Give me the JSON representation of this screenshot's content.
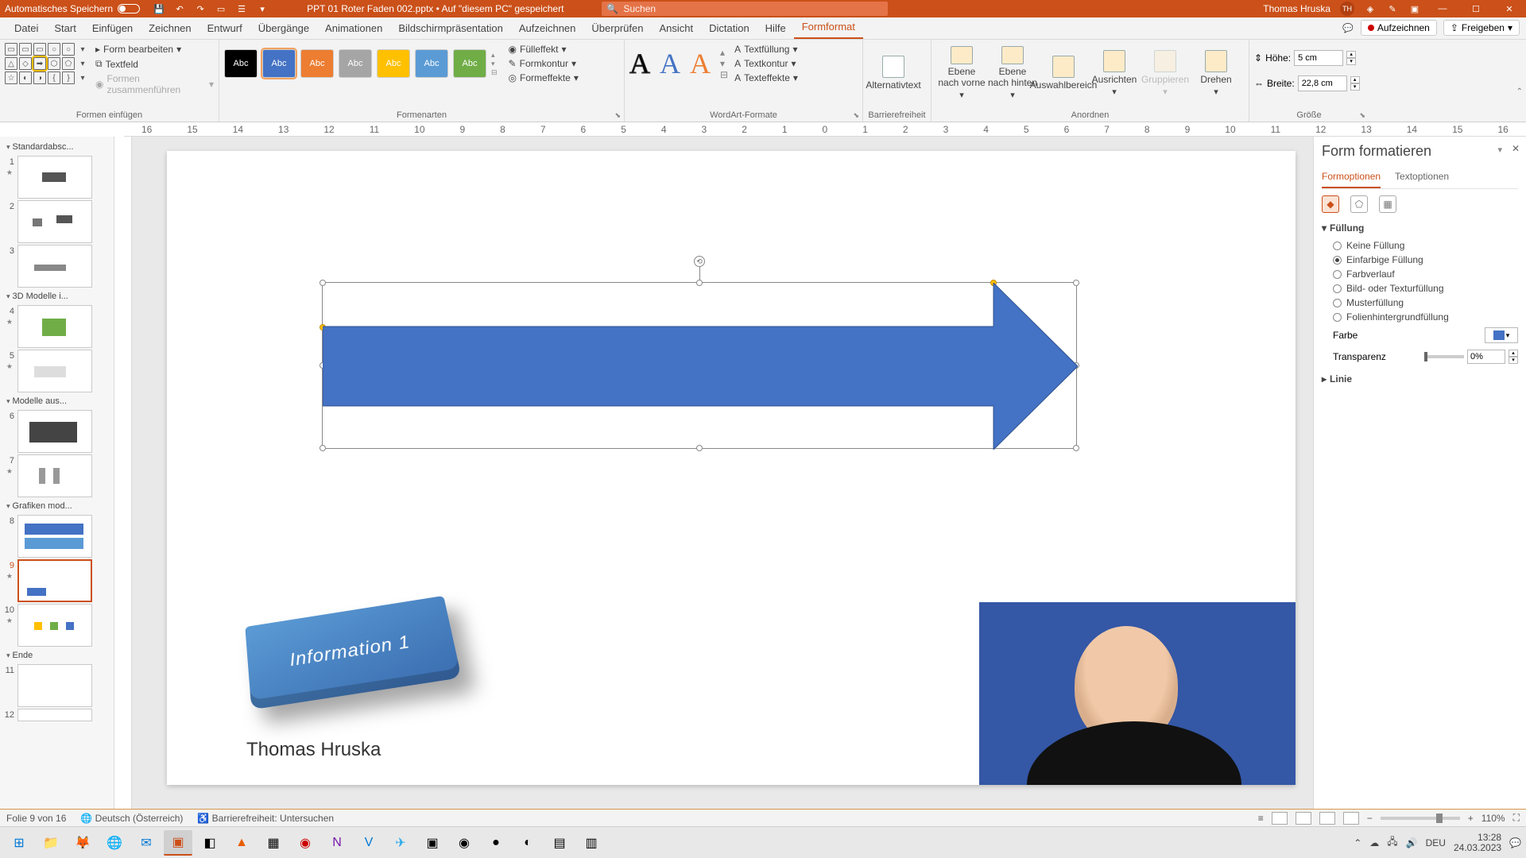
{
  "title_bar": {
    "autosave_label": "Automatisches Speichern",
    "filename": "PPT 01 Roter Faden 002.pptx • Auf \"diesem PC\" gespeichert",
    "search_placeholder": "Suchen",
    "user_name": "Thomas Hruska",
    "user_initials": "TH"
  },
  "tabs": {
    "items": [
      "Datei",
      "Start",
      "Einfügen",
      "Zeichnen",
      "Entwurf",
      "Übergänge",
      "Animationen",
      "Bildschirmpräsentation",
      "Aufzeichnen",
      "Überprüfen",
      "Ansicht",
      "Dictation",
      "Hilfe",
      "Formformat"
    ],
    "active": "Formformat",
    "record": "Aufzeichnen",
    "share": "Freigeben"
  },
  "ribbon": {
    "insert_shapes": {
      "edit_shape": "Form bearbeiten",
      "textbox": "Textfeld",
      "merge": "Formen zusammenführen",
      "group_label": "Formen einfügen"
    },
    "shape_styles": {
      "abc": "Abc",
      "fill": "Fülleffekt",
      "outline": "Formkontur",
      "effects": "Formeffekte",
      "group_label": "Formenarten"
    },
    "wordart": {
      "text_fill": "Textfüllung",
      "text_outline": "Textkontur",
      "text_effects": "Texteffekte",
      "group_label": "WordArt-Formate"
    },
    "accessibility": {
      "label": "Alternativtext",
      "group_label": "Barrierefreiheit"
    },
    "arrange": {
      "bring_forward": "Ebene nach vorne",
      "send_backward": "Ebene nach hinten",
      "selection_pane": "Auswahlbereich",
      "align": "Ausrichten",
      "group": "Gruppieren",
      "rotate": "Drehen",
      "group_label": "Anordnen"
    },
    "size": {
      "height_label": "Höhe:",
      "height_value": "5 cm",
      "width_label": "Breite:",
      "width_value": "22,8 cm",
      "group_label": "Größe"
    }
  },
  "thumbnails": {
    "sections": [
      {
        "name": "Standardabsc...",
        "slides": [
          1,
          2,
          3
        ]
      },
      {
        "name": "3D Modelle i...",
        "slides": [
          4,
          5
        ]
      },
      {
        "name": "Modelle aus...",
        "slides": [
          6,
          7
        ]
      },
      {
        "name": "Grafiken mod...",
        "slides": [
          8,
          9,
          10
        ]
      },
      {
        "name": "Ende",
        "slides": [
          11,
          12
        ]
      }
    ],
    "selected": 9
  },
  "slide": {
    "info_text": "Information 1",
    "author": "Thomas Hruska"
  },
  "format_pane": {
    "title": "Form formatieren",
    "tab_shape": "Formoptionen",
    "tab_text": "Textoptionen",
    "fill_section": "Füllung",
    "fill_options": {
      "none": "Keine Füllung",
      "solid": "Einfarbige Füllung",
      "gradient": "Farbverlauf",
      "picture": "Bild- oder Texturfüllung",
      "pattern": "Musterfüllung",
      "slide_bg": "Folienhintergrundfüllung"
    },
    "color_label": "Farbe",
    "transparency_label": "Transparenz",
    "transparency_value": "0%",
    "line_section": "Linie"
  },
  "status": {
    "slide_info": "Folie 9 von 16",
    "language": "Deutsch (Österreich)",
    "accessibility": "Barrierefreiheit: Untersuchen",
    "zoom": "110%"
  },
  "taskbar": {
    "lang": "DEU",
    "time": "13:28",
    "date": "24.03.2023"
  }
}
